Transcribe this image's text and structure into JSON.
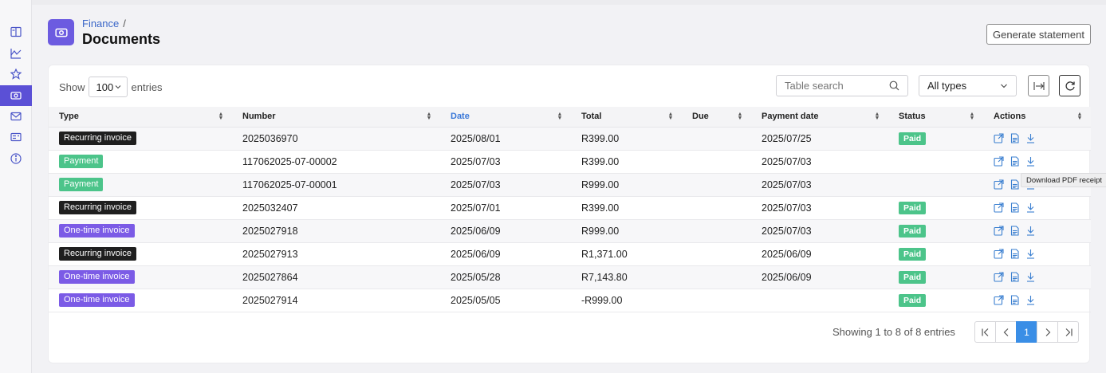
{
  "breadcrumb": {
    "parent": "Finance",
    "separator": "/"
  },
  "page_title": "Documents",
  "generate_button": "Generate statement",
  "controls": {
    "show_label": "Show",
    "page_size": "100",
    "entries_label": "entries",
    "search_placeholder": "Table search",
    "type_filter": "All types"
  },
  "columns": [
    "Type",
    "Number",
    "Date",
    "Total",
    "Due",
    "Payment date",
    "Status",
    "Actions"
  ],
  "sorted_column": "Date",
  "badge_colors": {
    "Recurring invoice": "#1f1f1f",
    "Payment": "#4cc48a",
    "One-time invoice": "#7b5be6"
  },
  "rows": [
    {
      "type": "Recurring invoice",
      "number": "2025036970",
      "date": "2025/08/01",
      "total": "R399.00",
      "due": "",
      "payment_date": "2025/07/25",
      "status": "Paid"
    },
    {
      "type": "Payment",
      "number": "117062025-07-00002",
      "date": "2025/07/03",
      "total": "R399.00",
      "due": "",
      "payment_date": "2025/07/03",
      "status": ""
    },
    {
      "type": "Payment",
      "number": "117062025-07-00001",
      "date": "2025/07/03",
      "total": "R999.00",
      "due": "",
      "payment_date": "2025/07/03",
      "status": ""
    },
    {
      "type": "Recurring invoice",
      "number": "2025032407",
      "date": "2025/07/01",
      "total": "R399.00",
      "due": "",
      "payment_date": "2025/07/03",
      "status": "Paid"
    },
    {
      "type": "One-time invoice",
      "number": "2025027918",
      "date": "2025/06/09",
      "total": "R999.00",
      "due": "",
      "payment_date": "2025/07/03",
      "status": "Paid"
    },
    {
      "type": "Recurring invoice",
      "number": "2025027913",
      "date": "2025/06/09",
      "total": "R1,371.00",
      "due": "",
      "payment_date": "2025/06/09",
      "status": "Paid"
    },
    {
      "type": "One-time invoice",
      "number": "2025027864",
      "date": "2025/05/28",
      "total": "R7,143.80",
      "due": "",
      "payment_date": "2025/06/09",
      "status": "Paid"
    },
    {
      "type": "One-time invoice",
      "number": "2025027914",
      "date": "2025/05/05",
      "total": "-R999.00",
      "due": "",
      "payment_date": "",
      "status": "Paid"
    }
  ],
  "tooltip": "Download PDF receipt",
  "summary": "Showing 1 to 8 of 8 entries",
  "pagination": {
    "current": "1"
  },
  "sidebar_icons": [
    "book-icon",
    "chart-icon",
    "star-icon",
    "billing-icon",
    "mail-icon",
    "card-icon",
    "info-icon"
  ],
  "row_action_icons": [
    "open-external-icon",
    "pdf-icon",
    "download-icon"
  ]
}
